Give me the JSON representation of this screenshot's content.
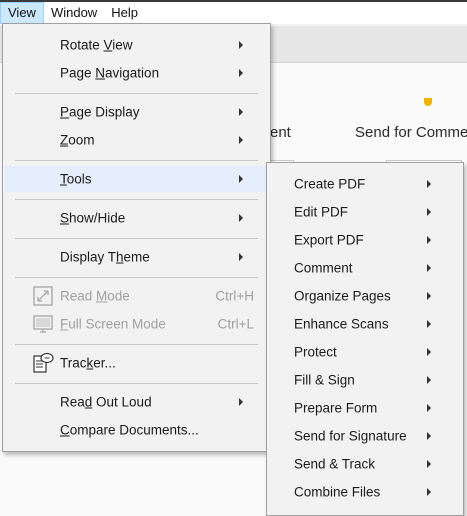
{
  "menubar": {
    "items": [
      "View",
      "Window",
      "Help"
    ]
  },
  "background": {
    "partial_label": "ent",
    "send_label": "Send for Comme"
  },
  "view_menu": {
    "items": [
      {
        "label": "Rotate View",
        "mnemonic": "V",
        "submenu": true
      },
      {
        "label": "Page Navigation",
        "mnemonic": "N",
        "submenu": true
      },
      {
        "label": "Page Display",
        "mnemonic": "P",
        "submenu": true
      },
      {
        "label": "Zoom",
        "mnemonic": "Z",
        "submenu": true
      },
      {
        "label": "Tools",
        "mnemonic": "T",
        "submenu": true,
        "highlighted": true
      },
      {
        "label": "Show/Hide",
        "mnemonic": "S",
        "submenu": true
      },
      {
        "label": "Display Theme",
        "mnemonic": "h",
        "submenu": true
      },
      {
        "label": "Read Mode",
        "mnemonic": "M",
        "shortcut": "Ctrl+H",
        "disabled": true,
        "icon": "read-mode-icon"
      },
      {
        "label": "Full Screen Mode",
        "mnemonic": "F",
        "shortcut": "Ctrl+L",
        "disabled": true,
        "icon": "full-screen-icon"
      },
      {
        "label": "Tracker...",
        "mnemonic": "k",
        "icon": "tracker-icon"
      },
      {
        "label": "Read Out Loud",
        "mnemonic": "d",
        "submenu": true
      },
      {
        "label": "Compare Documents...",
        "mnemonic": "C"
      }
    ]
  },
  "tools_submenu": {
    "items": [
      "Create PDF",
      "Edit PDF",
      "Export PDF",
      "Comment",
      "Organize Pages",
      "Enhance Scans",
      "Protect",
      "Fill & Sign",
      "Prepare Form",
      "Send for Signature",
      "Send & Track",
      "Combine Files"
    ]
  },
  "colors": {
    "menu_bg": "#f2f2f2",
    "highlight_bg": "#e4effb",
    "menubar_active_bg": "#cce8ff",
    "disabled_text": "#a0a0a0"
  }
}
